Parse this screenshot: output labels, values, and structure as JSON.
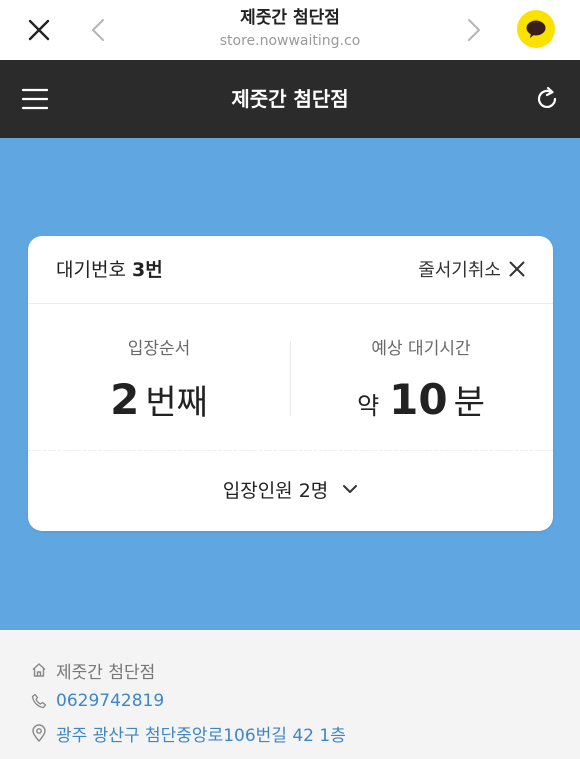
{
  "browser": {
    "title": "제줏간 첨단점",
    "url": "store.nowwaiting.co",
    "icons": {
      "close": "close-icon",
      "back": "chevron-left-icon",
      "forward": "chevron-right-icon",
      "kakaotalk": "kakaotalk-icon"
    }
  },
  "header": {
    "title": "제줏간 첨단점",
    "icons": {
      "menu": "hamburger-menu-icon",
      "refresh": "refresh-icon"
    }
  },
  "card": {
    "queue_label": "대기번호",
    "queue_number": "3번",
    "cancel_label": "줄서기취소",
    "position": {
      "label": "입장순서",
      "number": "2",
      "unit": "번째"
    },
    "wait": {
      "label": "예상 대기시간",
      "prefix": "약",
      "number": "10",
      "unit": "분"
    },
    "party": {
      "label": "입장인원 2명"
    }
  },
  "store": {
    "name": "제줏간 첨단점",
    "phone": "0629742819",
    "address": "광주 광산구 첨단중앙로106번길 42 1층"
  },
  "colors": {
    "brand_blue": "#60a7e2",
    "header_dark": "#2b2b2b",
    "kakao_yellow": "#fae100",
    "link_blue": "#3e86c9"
  }
}
